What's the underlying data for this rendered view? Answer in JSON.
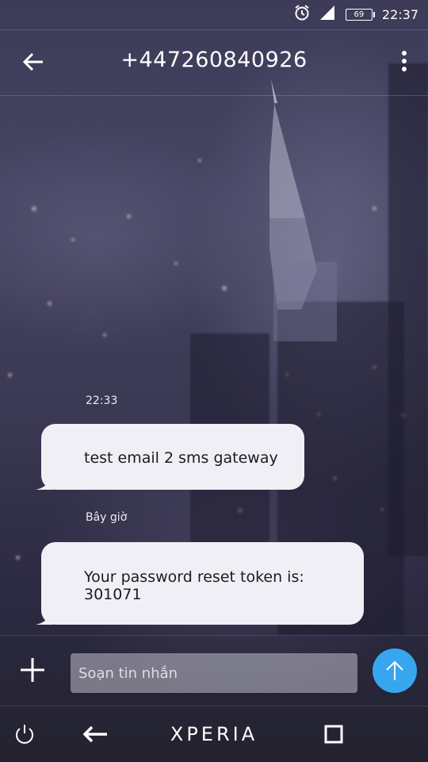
{
  "status_bar": {
    "battery_level": "69",
    "time": "22:37",
    "icons": [
      "alarm-icon",
      "signal-icon",
      "battery-icon"
    ]
  },
  "app_bar": {
    "title": "+447260840926",
    "back_icon": "arrow-left-icon",
    "menu_icon": "more-vert-icon"
  },
  "messages": [
    {
      "timestamp": "22:33",
      "text": "test email 2 sms gateway"
    },
    {
      "timestamp": "Bây giờ",
      "text_lines": [
        "Your password reset token is:",
        "301071"
      ]
    }
  ],
  "compose": {
    "placeholder": "Soạn tin nhắn",
    "attach_icon": "plus-icon",
    "send_icon": "arrow-up-icon",
    "send_color": "#38a6ee"
  },
  "nav_bar": {
    "brand": "XPERIA",
    "icons": [
      "power-icon",
      "back-arrow-icon",
      "recents-square-icon"
    ]
  }
}
